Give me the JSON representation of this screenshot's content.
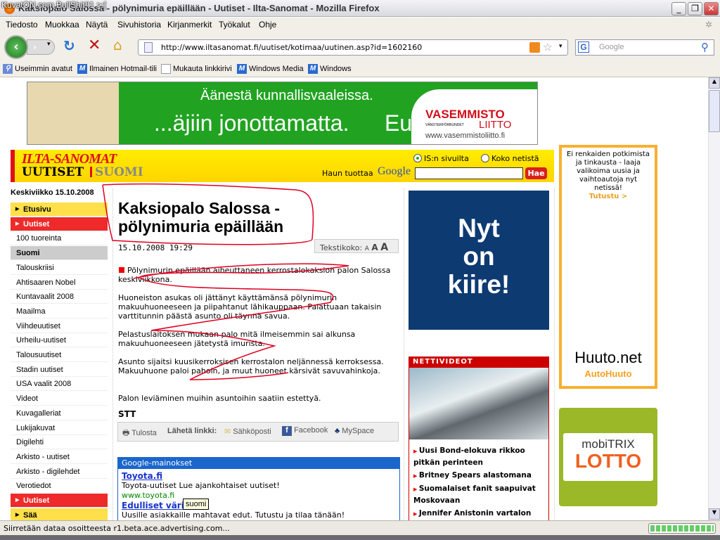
{
  "window": {
    "watermark": "KuvatON.com BullShit!!1 >:[",
    "title": "Kaksiopalo Salossa - pölynimuria epäillään - Uutiset - Ilta-Sanomat - Mozilla Firefox",
    "min": "_",
    "max": "❐",
    "close": "✕"
  },
  "menu": [
    "Tiedosto",
    "Muokkaa",
    "Näytä",
    "Sivuhistoria",
    "Kirjanmerkit",
    "Työkalut",
    "Ohje"
  ],
  "toolbar": {
    "url": "http://www.iltasanomat.fi/uutiset/kotimaa/uutinen.asp?id=1602160",
    "search_placeholder": "Google"
  },
  "bookmarks": [
    "Useimmin avatut",
    "Ilmainen Hotmail-tili",
    "Mukauta linkkirivi",
    "Windows Media",
    "Windows"
  ],
  "banner": {
    "line1": "Äänestä kunnallisvaaleissa.",
    "line2": "...äjiin jonottamatta.",
    "eu": "Eu",
    "brand": "VASEMMISTO",
    "brand2": "LIITTO",
    "sub": "VÄNSTERFÖRBUNDET",
    "site": "www.vasemmistoliitto.fi"
  },
  "header": {
    "logo": "ILTA-SANOMAT",
    "section": "UUTISET",
    "sub": "SUOMI",
    "radio1": "IS:n sivuilta",
    "radio2": "Koko netistä",
    "powered": "Haun tuottaa",
    "google": "Google",
    "search_button": "Hae"
  },
  "date": "Keskiviikko 15.10.2008",
  "nav": [
    {
      "l": "Etusivu",
      "s": "y"
    },
    {
      "l": "Uutiset",
      "s": "r"
    },
    {
      "l": "100 tuoreinta",
      "s": ""
    },
    {
      "l": "Suomi",
      "s": "g"
    },
    {
      "l": "Talouskriisi",
      "s": ""
    },
    {
      "l": "Ahtisaaren Nobel",
      "s": ""
    },
    {
      "l": "Kuntavaalit 2008",
      "s": ""
    },
    {
      "l": "Maailma",
      "s": ""
    },
    {
      "l": "Viihdeuutiset",
      "s": ""
    },
    {
      "l": "Urheilu-uutiset",
      "s": ""
    },
    {
      "l": "Talousuutiset",
      "s": ""
    },
    {
      "l": "Stadin uutiset",
      "s": ""
    },
    {
      "l": "USA vaalit 2008",
      "s": ""
    },
    {
      "l": "Videot",
      "s": ""
    },
    {
      "l": "Kuvagalleriat",
      "s": ""
    },
    {
      "l": "Lukijakuvat",
      "s": ""
    },
    {
      "l": "Digilehti",
      "s": ""
    },
    {
      "l": "Arkisto - uutiset",
      "s": ""
    },
    {
      "l": "Arkisto - digilehdet",
      "s": ""
    },
    {
      "l": "Verotiedot",
      "s": ""
    },
    {
      "l": "Uutiset",
      "s": "r"
    },
    {
      "l": "Sää",
      "s": "y"
    }
  ],
  "article": {
    "title": "Kaksiopalo Salossa - pölynimuria epäillään",
    "timestamp": "15.10.2008 19:29",
    "textsize_label": "Tekstikoko:",
    "textsize": [
      "A",
      "A",
      "A"
    ],
    "paragraphs": [
      "Pölynimurin epäillään aiheuttaneen kerrostalokaksion palon Salossa keskiviikkona.",
      "Huoneiston asukas oli jättänyt käyttämänsä pölynimurin makuuhuoneeseen ja piipahtanut lähikauppaan. Palattuaan takaisin varttitunnin päästä asunto oli täynnä savua.",
      "Pelastuslaitoksen mukaan palo mitä ilmeisemmin sai alkunsa makuuhuoneeseen jätetystä imurista.",
      "Asunto sijaitsi kuusikerroksisen kerrostalon neljännessä kerroksessa. Makuuhuone paloi pahoin, ja muut huoneet kärsivät savuvahinkoja.",
      "Palon leviäminen muihin asuntoihin saatiin estettyä."
    ],
    "source": "STT"
  },
  "share": {
    "print": "Tulosta",
    "send": "Lähetä linkki:",
    "email": "Sähköposti",
    "facebook": "Facebook",
    "myspace": "MySpace"
  },
  "ads": {
    "header": "Google-mainokset",
    "items": [
      {
        "title": "Toyota.fi",
        "text": "Toyota-uutiset Lue ajankohtaiset uutiset!",
        "url": "www.toyota.fi"
      },
      {
        "title": "Edulliset värit",
        "text": "Uusille asiakkaille mahtavat edut. Tutustu ja tilaa tänään!"
      }
    ]
  },
  "tooltip": "suomi",
  "blue_ad": [
    "Nyt",
    "on",
    "kiire!"
  ],
  "nettivideot": {
    "title": "NETTIVIDEOT",
    "items": [
      "Uusi Bond-elokuva rikkoo pitkän perinteen",
      "Britney Spears alastomana",
      "Suomalaiset fanit saapuivat Moskovaan",
      "Jennifer Anistonin vartalon"
    ]
  },
  "huuto_ad": {
    "text": "Ei renkaiden potkimista ja tinkausta - laaja valikoima uusia ja vaihtoautoja nyt netissä!",
    "cta": "Tutustu >",
    "brand": "Huuto.net",
    "sub": "AutoHuuto"
  },
  "mobitrix": {
    "l1": "mobiTRIX",
    "l2": "LOTTO"
  },
  "status": "Siirretään dataa osoitteesta r1.beta.ace.advertising.com...",
  "progress": 1.0
}
